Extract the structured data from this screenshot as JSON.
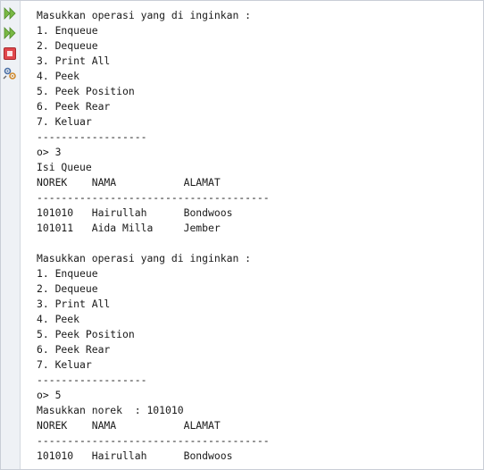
{
  "toolbar": {
    "buttons": [
      {
        "name": "rerun-icon",
        "color": "#6fae3c"
      },
      {
        "name": "rerun-with-params-icon",
        "color": "#6fae3c"
      },
      {
        "name": "stop-icon",
        "color": "#e0474c"
      },
      {
        "name": "settings-icon",
        "color": "#4a6fa5"
      }
    ]
  },
  "console": {
    "lines": [
      "Masukkan operasi yang di inginkan :",
      "1. Enqueue",
      "2. Dequeue",
      "3. Print All",
      "4. Peek",
      "5. Peek Position",
      "6. Peek Rear",
      "7. Keluar",
      "------------------",
      "o> 3",
      "Isi Queue",
      "NOREK    NAMA           ALAMAT",
      "--------------------------------------",
      "101010   Hairullah      Bondwoos",
      "101011   Aida Milla     Jember",
      "",
      "Masukkan operasi yang di inginkan :",
      "1. Enqueue",
      "2. Dequeue",
      "3. Print All",
      "4. Peek",
      "5. Peek Position",
      "6. Peek Rear",
      "7. Keluar",
      "------------------",
      "o> 5",
      "Masukkan norek  : 101010",
      "NOREK    NAMA           ALAMAT",
      "--------------------------------------",
      "101010   Hairullah      Bondwoos"
    ]
  }
}
